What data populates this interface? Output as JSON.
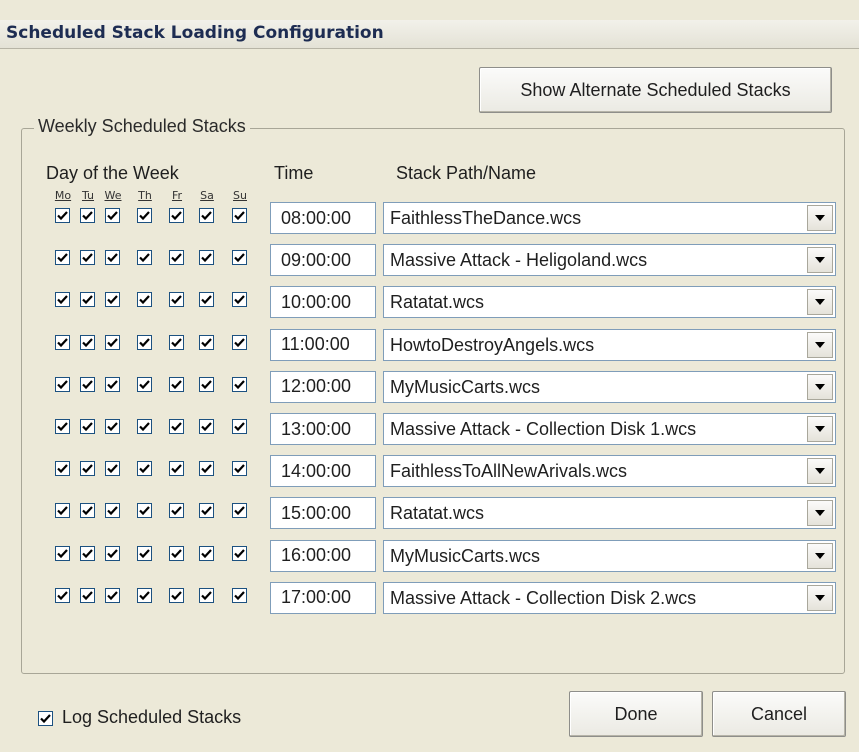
{
  "title": "Scheduled Stack Loading Configuration",
  "buttons": {
    "show_alternate": "Show Alternate Scheduled Stacks",
    "done": "Done",
    "cancel": "Cancel"
  },
  "group": {
    "label": "Weekly Scheduled Stacks",
    "col_day": "Day of the Week",
    "col_time": "Time",
    "col_stack": "Stack Path/Name",
    "days": [
      "Mo",
      "Tu",
      "We",
      "Th",
      "Fr",
      "Sa",
      "Su"
    ]
  },
  "rows": [
    {
      "time": "08:00:00",
      "stack": "FaithlessTheDance.wcs",
      "days": [
        true,
        true,
        true,
        true,
        true,
        true,
        true
      ]
    },
    {
      "time": "09:00:00",
      "stack": "Massive Attack - Heligoland.wcs",
      "days": [
        true,
        true,
        true,
        true,
        true,
        true,
        true
      ]
    },
    {
      "time": "10:00:00",
      "stack": "Ratatat.wcs",
      "days": [
        true,
        true,
        true,
        true,
        true,
        true,
        true
      ]
    },
    {
      "time": "11:00:00",
      "stack": "HowtoDestroyAngels.wcs",
      "days": [
        true,
        true,
        true,
        true,
        true,
        true,
        true
      ]
    },
    {
      "time": "12:00:00",
      "stack": "MyMusicCarts.wcs",
      "days": [
        true,
        true,
        true,
        true,
        true,
        true,
        true
      ]
    },
    {
      "time": "13:00:00",
      "stack": "Massive Attack - Collection Disk 1.wcs",
      "days": [
        true,
        true,
        true,
        true,
        true,
        true,
        true
      ]
    },
    {
      "time": "14:00:00",
      "stack": "FaithlessToAllNewArivals.wcs",
      "days": [
        true,
        true,
        true,
        true,
        true,
        true,
        true
      ]
    },
    {
      "time": "15:00:00",
      "stack": "Ratatat.wcs",
      "days": [
        true,
        true,
        true,
        true,
        true,
        true,
        true
      ]
    },
    {
      "time": "16:00:00",
      "stack": "MyMusicCarts.wcs",
      "days": [
        true,
        true,
        true,
        true,
        true,
        true,
        true
      ]
    },
    {
      "time": "17:00:00",
      "stack": "Massive Attack - Collection Disk 2.wcs",
      "days": [
        true,
        true,
        true,
        true,
        true,
        true,
        true
      ]
    }
  ],
  "log": {
    "label": "Log Scheduled Stacks",
    "checked": true
  }
}
